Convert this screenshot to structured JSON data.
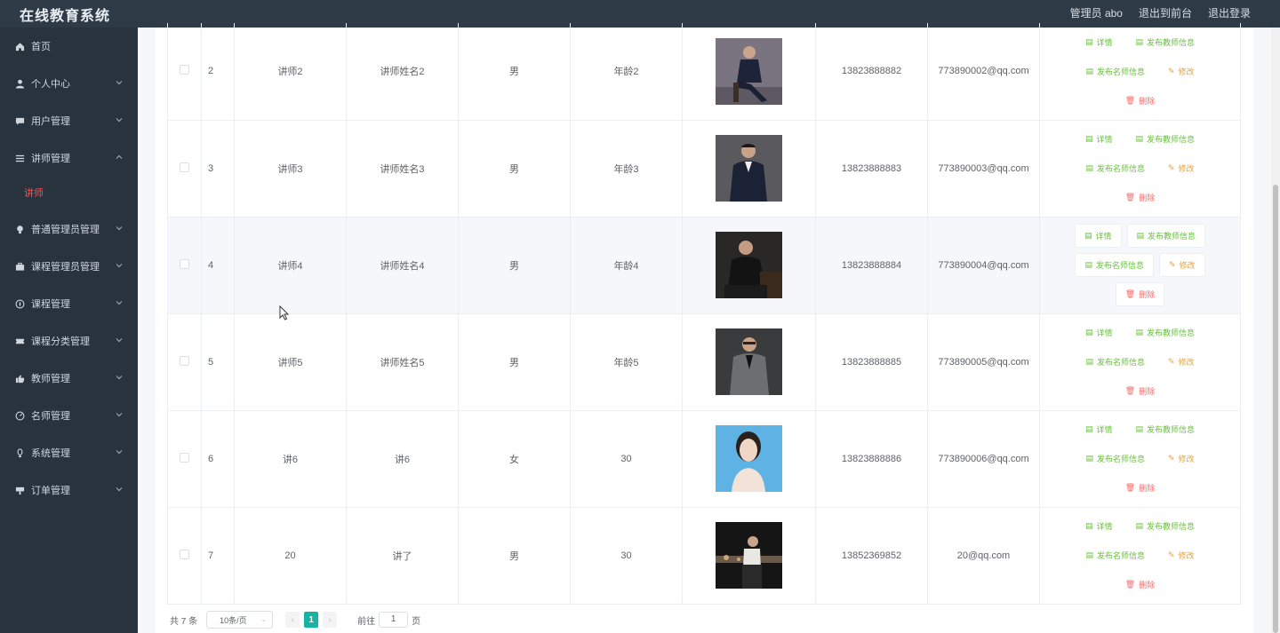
{
  "header": {
    "brand": "在线教育系统",
    "admin": "管理员 abo",
    "to_front": "退出到前台",
    "logout": "退出登录"
  },
  "sidebar": {
    "items": [
      {
        "label": "首页",
        "icon": "home-icon",
        "arrow": ""
      },
      {
        "label": "个人中心",
        "icon": "user-icon",
        "arrow": "down"
      },
      {
        "label": "用户管理",
        "icon": "chat-icon",
        "arrow": "down"
      },
      {
        "label": "讲师管理",
        "icon": "menu-icon",
        "arrow": "up"
      },
      {
        "label": "普通管理员管理",
        "icon": "bulb-icon",
        "arrow": "down"
      },
      {
        "label": "课程管理员管理",
        "icon": "briefcase-icon",
        "arrow": "down"
      },
      {
        "label": "课程管理",
        "icon": "compass-icon",
        "arrow": "down"
      },
      {
        "label": "课程分类管理",
        "icon": "ticket-icon",
        "arrow": "down"
      },
      {
        "label": "教师管理",
        "icon": "thumb-icon",
        "arrow": "down"
      },
      {
        "label": "名师管理",
        "icon": "gauge-icon",
        "arrow": "down"
      },
      {
        "label": "系统管理",
        "icon": "bulb2-icon",
        "arrow": "down"
      },
      {
        "label": "订单管理",
        "icon": "flag-icon",
        "arrow": "down"
      }
    ],
    "active_sub": "讲师"
  },
  "table": {
    "rows": [
      {
        "id": "2",
        "account": "讲师2",
        "name": "讲师姓名2",
        "gender": "男",
        "age": "年龄2",
        "phone": "13823888882",
        "email": "773890002@qq.com"
      },
      {
        "id": "3",
        "account": "讲师3",
        "name": "讲师姓名3",
        "gender": "男",
        "age": "年龄3",
        "phone": "13823888883",
        "email": "773890003@qq.com"
      },
      {
        "id": "4",
        "account": "讲师4",
        "name": "讲师姓名4",
        "gender": "男",
        "age": "年龄4",
        "phone": "13823888884",
        "email": "773890004@qq.com"
      },
      {
        "id": "5",
        "account": "讲师5",
        "name": "讲师姓名5",
        "gender": "男",
        "age": "年龄5",
        "phone": "13823888885",
        "email": "773890005@qq.com"
      },
      {
        "id": "6",
        "account": "讲6",
        "name": "讲6",
        "gender": "女",
        "age": "30",
        "phone": "13823888886",
        "email": "773890006@qq.com"
      },
      {
        "id": "7",
        "account": "20",
        "name": "讲了",
        "gender": "男",
        "age": "30",
        "phone": "13852369852",
        "email": "20@qq.com"
      }
    ],
    "actions": {
      "detail": "详情",
      "publish_teacher": "发布教师信息",
      "publish_famous": "发布名师信息",
      "edit": "修改",
      "delete": "删除"
    }
  },
  "pagination": {
    "total": "共 7 条",
    "page_size": "10条/页",
    "prev": "‹",
    "current": "1",
    "next": "›",
    "goto_label": "前往",
    "goto_value": "1",
    "page_suffix": "页"
  },
  "colors": {
    "topbar": "#2f3a47",
    "sidebar": "#28333e",
    "active_sub": "#ff4d4f",
    "pager_active": "#17b3a3",
    "action_green": "#67c23a",
    "action_yellow": "#e6a23c",
    "action_red": "#f56c6c"
  }
}
